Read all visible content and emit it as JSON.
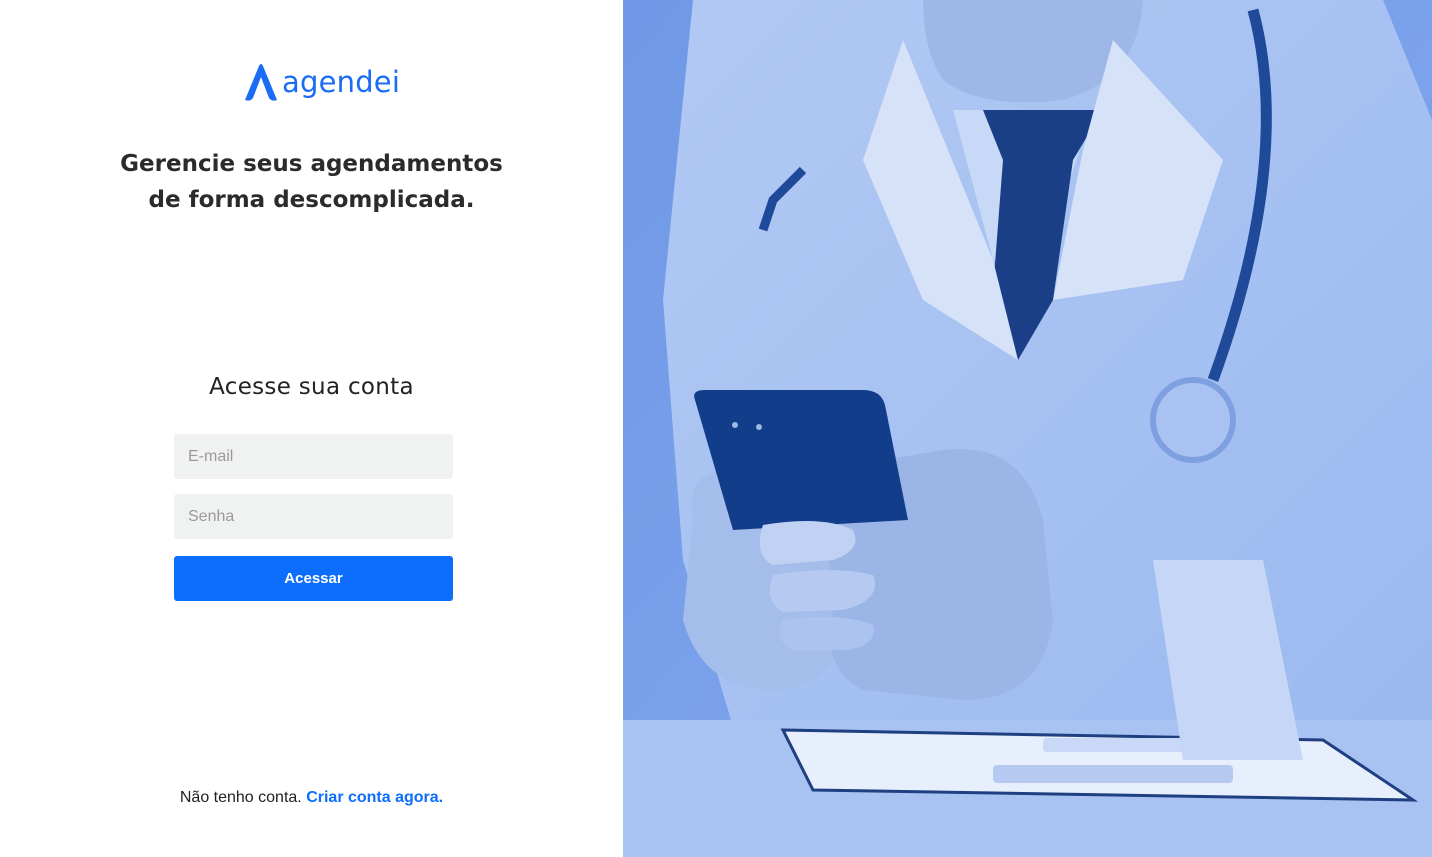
{
  "brand": {
    "name": "agendei",
    "color": "#1a6cf5"
  },
  "tagline": {
    "line1": "Gerencie seus agendamentos",
    "line2": "de forma descomplicada."
  },
  "login": {
    "title": "Acesse sua conta",
    "email_placeholder": "E-mail",
    "email_value": "",
    "password_placeholder": "Senha",
    "password_value": "",
    "submit_label": "Acessar"
  },
  "signup": {
    "prompt": "Não tenho conta.",
    "link_label": "Criar conta agora."
  },
  "hero": {
    "icon": "doctor-with-phone-photo",
    "tint_color": "#7fa7ec"
  },
  "colors": {
    "primary": "#0d6efd",
    "input_bg": "#f0f2f2",
    "text_dark": "#2b2b2b"
  }
}
